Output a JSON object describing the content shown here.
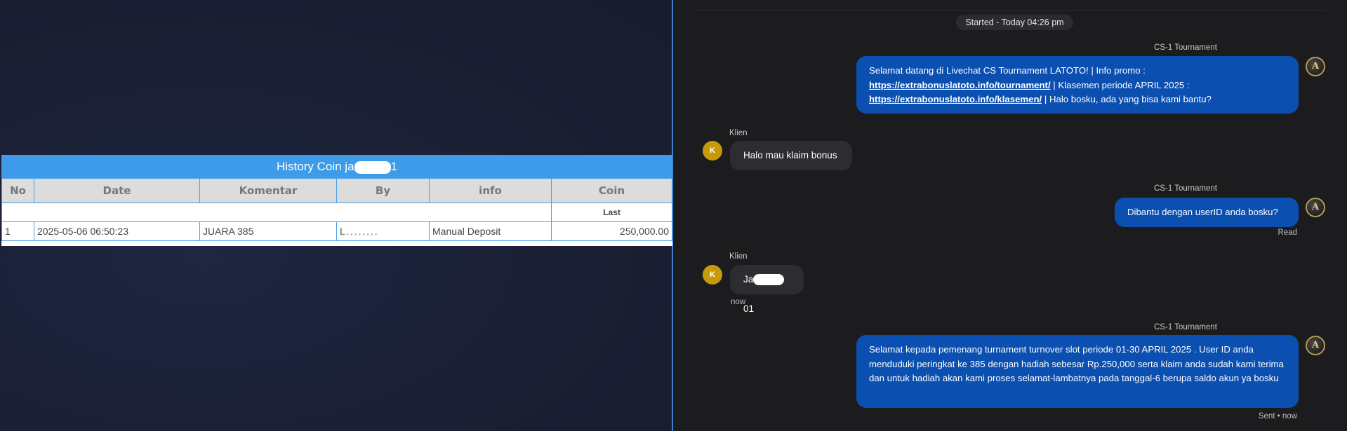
{
  "history": {
    "title": "History Coin ja",
    "title_suffix": "1",
    "columns": [
      "No",
      "Date",
      "Komentar",
      "By",
      "info",
      "Coin"
    ],
    "last_label": "Last",
    "rows": [
      {
        "no": "1",
        "date": "2025-05-06 06:50:23",
        "komentar": "JUARA 385",
        "by": "L . . . . . . . .",
        "info": "Manual Deposit",
        "coin": "250,000.00"
      }
    ]
  },
  "chat": {
    "started": "Started - Today 04:26 pm",
    "agent_name": "CS-1 Tournament",
    "client_name": "Klien",
    "client_initial": "K",
    "agent_initial": "A",
    "msg1": {
      "p1": "Selamat datang di Livechat CS Tournament LATOTO! | Info promo :",
      "link1": "https://extrabonuslatoto.info/tournament/",
      "p2": " | Klasemen periode APRIL 2025 :",
      "link2": "https://extrabonuslatoto.info/klasemen/",
      "p3": " | Halo bosku, ada yang bisa kami bantu?"
    },
    "msg2": "Halo mau klaim bonus",
    "msg3": "Dibantu dengan userID anda bosku?",
    "msg3_status": "Read",
    "msg4_prefix": "Ja",
    "msg4_suffix": "01",
    "msg4_time": "now",
    "msg5": "Selamat kepada pemenang turnament turnover slot periode 01-30 APRIL 2025 . User ID anda menduduki peringkat ke 385 dengan hadiah sebesar Rp.250,000 serta klaim anda sudah kami terima dan untuk hadiah akan kami proses selamat-lambatnya pada tanggal-6 berupa saldo akun ya bosku",
    "msg5_status": "Sent • now"
  }
}
